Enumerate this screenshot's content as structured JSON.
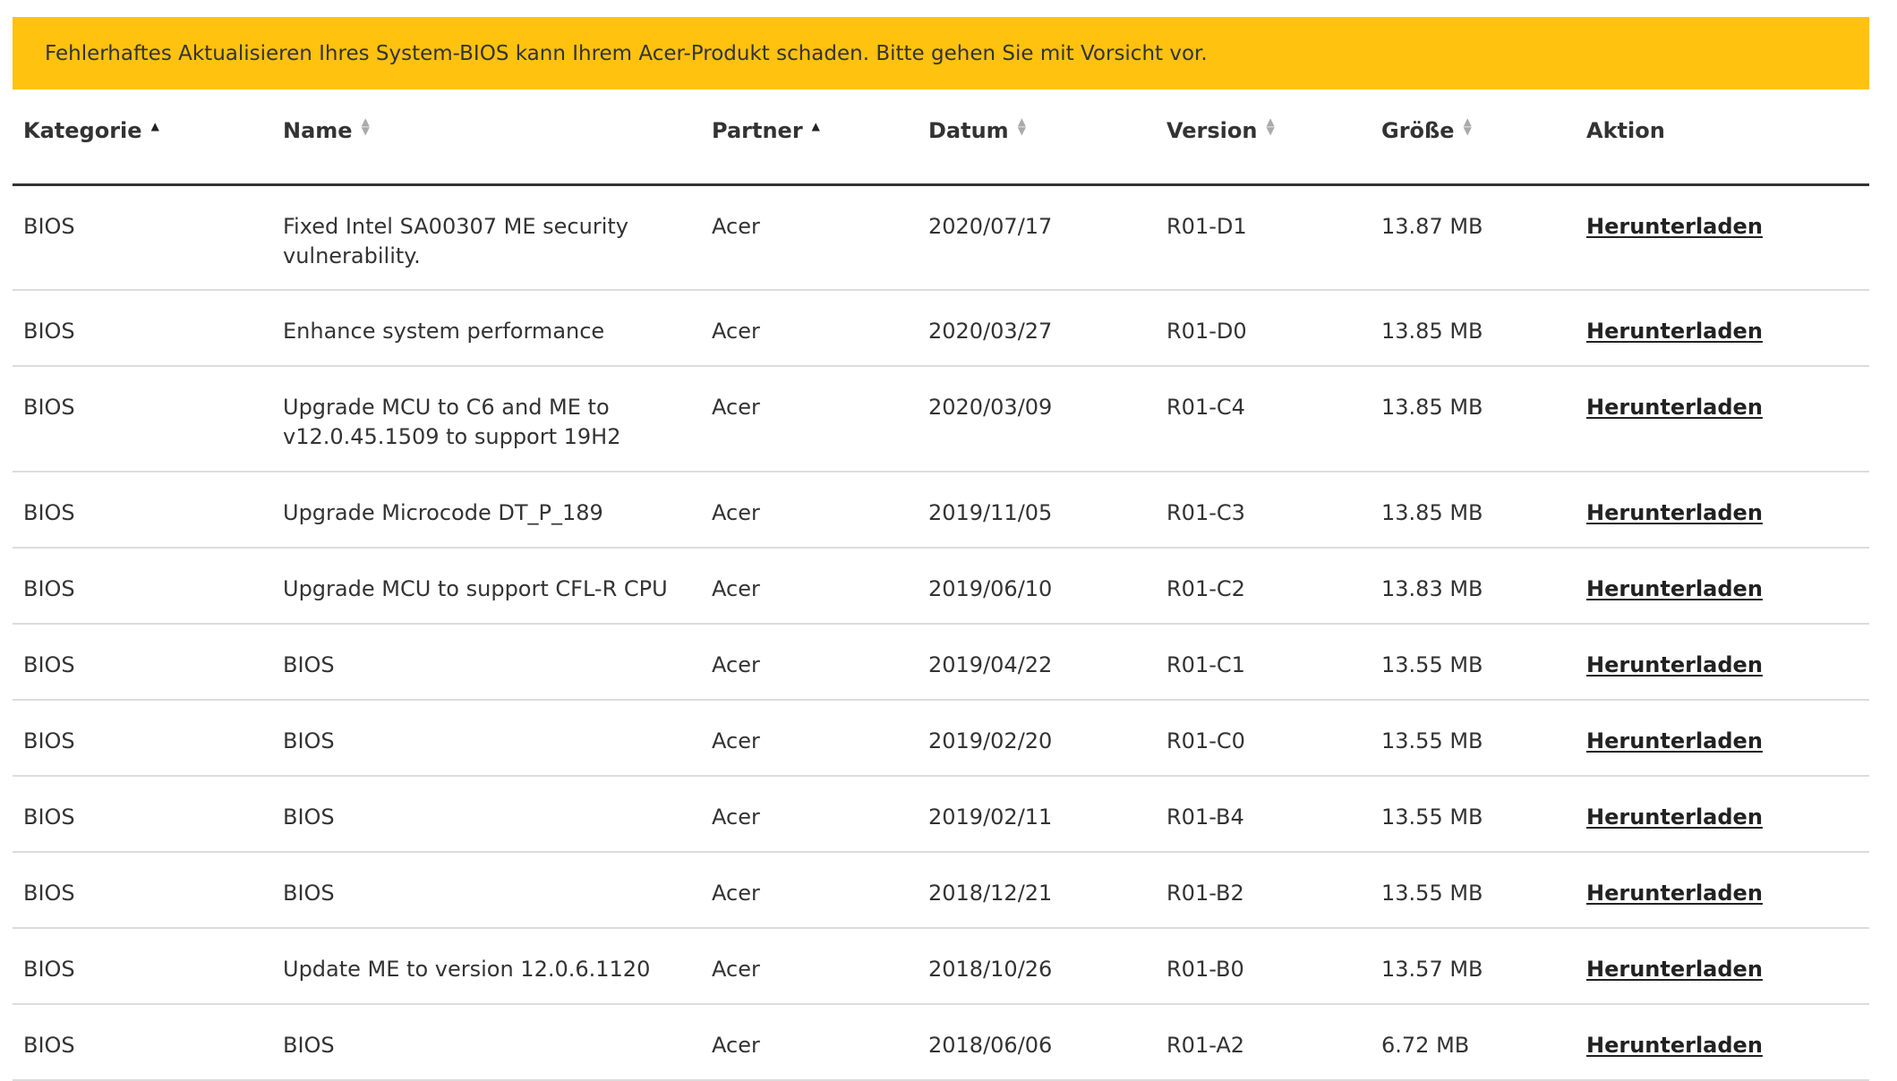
{
  "warning": {
    "text": "Fehlerhaftes Aktualisieren Ihres System-BIOS kann Ihrem Acer-Produkt schaden. Bitte gehen Sie mit Vorsicht vor."
  },
  "table": {
    "headers": {
      "category": "Kategorie",
      "name": "Name",
      "partner": "Partner",
      "date": "Datum",
      "version": "Version",
      "size": "Größe",
      "action": "Aktion"
    },
    "sort_state": {
      "category": "ascending",
      "name": "unsorted",
      "partner": "ascending",
      "date": "unsorted",
      "version": "unsorted",
      "size": "unsorted"
    },
    "rows": [
      {
        "category": "BIOS",
        "name": "Fixed Intel SA00307 ME security vulnerability.",
        "partner": "Acer",
        "date": "2020/07/17",
        "version": "R01-D1",
        "size": "13.87 MB",
        "action": "Herunterladen"
      },
      {
        "category": "BIOS",
        "name": "Enhance system performance",
        "partner": "Acer",
        "date": "2020/03/27",
        "version": "R01-D0",
        "size": "13.85 MB",
        "action": "Herunterladen"
      },
      {
        "category": "BIOS",
        "name": "Upgrade MCU to C6 and ME to v12.0.45.1509 to support 19H2",
        "partner": "Acer",
        "date": "2020/03/09",
        "version": "R01-C4",
        "size": "13.85 MB",
        "action": "Herunterladen"
      },
      {
        "category": "BIOS",
        "name": "Upgrade Microcode DT_P_189",
        "partner": "Acer",
        "date": "2019/11/05",
        "version": "R01-C3",
        "size": "13.85 MB",
        "action": "Herunterladen"
      },
      {
        "category": "BIOS",
        "name": "Upgrade MCU to support CFL-R CPU",
        "partner": "Acer",
        "date": "2019/06/10",
        "version": "R01-C2",
        "size": "13.83 MB",
        "action": "Herunterladen"
      },
      {
        "category": "BIOS",
        "name": "BIOS",
        "partner": "Acer",
        "date": "2019/04/22",
        "version": "R01-C1",
        "size": "13.55 MB",
        "action": "Herunterladen"
      },
      {
        "category": "BIOS",
        "name": "BIOS",
        "partner": "Acer",
        "date": "2019/02/20",
        "version": "R01-C0",
        "size": "13.55 MB",
        "action": "Herunterladen"
      },
      {
        "category": "BIOS",
        "name": "BIOS",
        "partner": "Acer",
        "date": "2019/02/11",
        "version": "R01-B4",
        "size": "13.55 MB",
        "action": "Herunterladen"
      },
      {
        "category": "BIOS",
        "name": "BIOS",
        "partner": "Acer",
        "date": "2018/12/21",
        "version": "R01-B2",
        "size": "13.55 MB",
        "action": "Herunterladen"
      },
      {
        "category": "BIOS",
        "name": "Update ME to version 12.0.6.1120",
        "partner": "Acer",
        "date": "2018/10/26",
        "version": "R01-B0",
        "size": "13.57 MB",
        "action": "Herunterladen"
      },
      {
        "category": "BIOS",
        "name": "BIOS",
        "partner": "Acer",
        "date": "2018/06/06",
        "version": "R01-A2",
        "size": "6.72 MB",
        "action": "Herunterladen"
      }
    ]
  },
  "colors": {
    "warning_bg": "#FFC20E",
    "text": "#333333",
    "row_divider": "#dcdcdc",
    "header_divider": "#333333"
  },
  "icons": {
    "sort_ascending": "sort-ascending-icon",
    "sort_unsorted": "sort-both-icon"
  }
}
